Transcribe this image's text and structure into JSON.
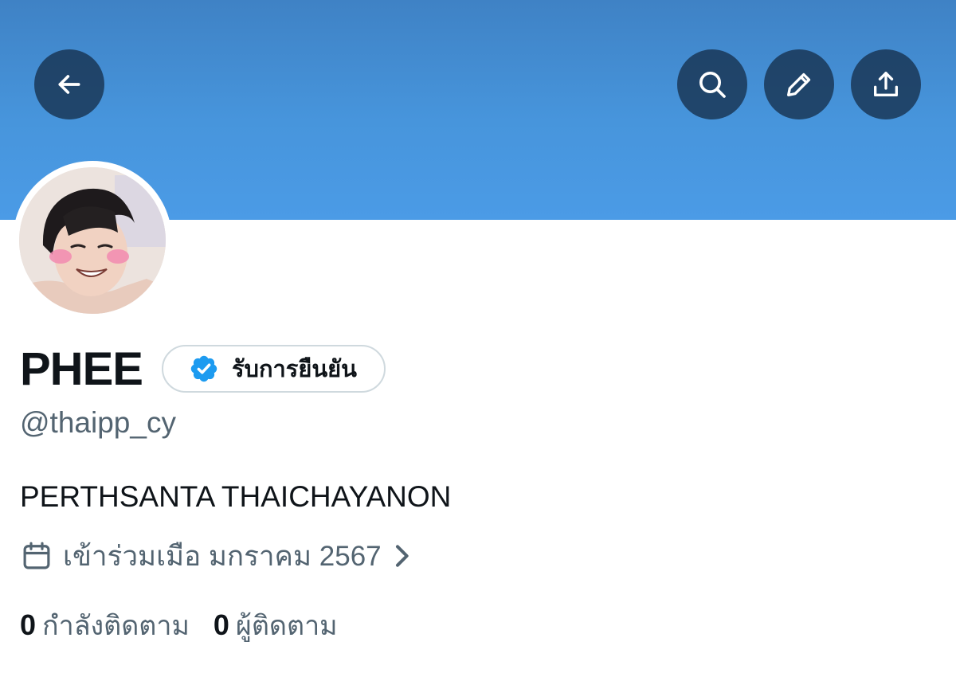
{
  "header": {
    "back_icon": "arrow-left-icon",
    "search_icon": "search-icon",
    "edit_icon": "pencil-icon",
    "share_icon": "share-upload-icon",
    "banner_color": "#4795dc"
  },
  "profile": {
    "display_name": "PHEE",
    "verified_label": "รับการยืนยัน",
    "verified_color": "#1d9bf0",
    "handle": "@thaipp_cy",
    "bio": "PERTHSANTA THAICHAYANON",
    "joined_icon": "calendar-icon",
    "joined_text": "เข้าร่วมเมือ มกราคม 2567"
  },
  "stats": {
    "following_count": "0",
    "following_label": "กำลังติดตาม",
    "followers_count": "0",
    "followers_label": "ผู้ติดตาม"
  }
}
